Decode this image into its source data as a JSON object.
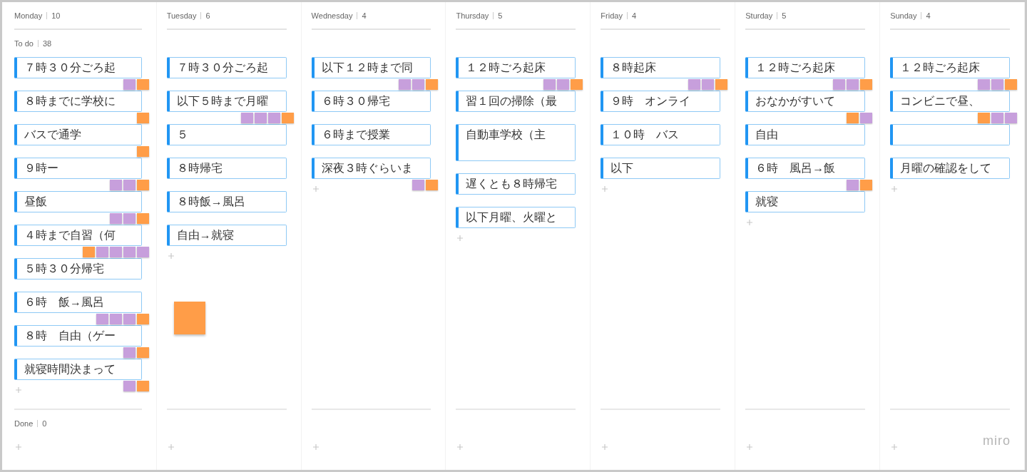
{
  "columns": [
    {
      "day": "Monday",
      "count": "10",
      "lane": {
        "label": "To do",
        "count": "38"
      },
      "cards": [
        {
          "text": "７時３０分ごろ起",
          "stickies": [
            {
              "color": "#c79fdc"
            },
            {
              "color": "#ff9d48"
            }
          ]
        },
        {
          "text": "８時までに学校に",
          "stickies": [
            {
              "color": "#ff9d48"
            }
          ]
        },
        {
          "text": "バスで通学",
          "stickies": [
            {
              "color": "#ff9d48"
            }
          ]
        },
        {
          "text": "９時ー",
          "stickies": [
            {
              "color": "#c79fdc"
            },
            {
              "color": "#c79fdc"
            },
            {
              "color": "#ff9d48"
            }
          ]
        },
        {
          "text": "昼飯",
          "stickies": [
            {
              "color": "#c79fdc"
            },
            {
              "color": "#c79fdc"
            },
            {
              "color": "#ff9d48"
            }
          ]
        },
        {
          "text": "４時まで自習（何",
          "stickies": [
            {
              "color": "#ff9d48"
            },
            {
              "color": "#c79fdc"
            },
            {
              "color": "#c79fdc"
            },
            {
              "color": "#c79fdc"
            },
            {
              "color": "#c79fdc"
            }
          ]
        },
        {
          "text": "５時３０分帰宅"
        },
        {
          "text": "６時　飯→風呂",
          "stickies": [
            {
              "color": "#c79fdc"
            },
            {
              "color": "#c79fdc"
            },
            {
              "color": "#c79fdc"
            },
            {
              "color": "#ff9d48"
            }
          ]
        },
        {
          "text": "８時　自由（ゲー",
          "stickies": [
            {
              "color": "#c79fdc"
            },
            {
              "color": "#ff9d48"
            }
          ]
        },
        {
          "text": "就寝時間決まって",
          "stickies": [
            {
              "color": "#c79fdc"
            },
            {
              "color": "#ff9d48"
            }
          ]
        }
      ]
    },
    {
      "day": "Tuesday",
      "count": "6",
      "cards": [
        {
          "text": "７時３０分ごろ起"
        },
        {
          "text": "以下５時まで月曜",
          "stickies": [
            {
              "color": "#c79fdc"
            },
            {
              "color": "#c79fdc"
            },
            {
              "color": "#c79fdc"
            },
            {
              "color": "#ff9d48"
            }
          ]
        },
        {
          "text": "５"
        },
        {
          "text": "８時帰宅"
        },
        {
          "text": "８時飯→風呂"
        },
        {
          "text": "自由→就寝"
        }
      ],
      "loose": [
        {
          "color": "#ff9d48"
        }
      ]
    },
    {
      "day": "Wednesday",
      "count": "4",
      "cards": [
        {
          "text": "以下１２時まで同",
          "stickies": [
            {
              "color": "#c79fdc"
            },
            {
              "color": "#c79fdc"
            },
            {
              "color": "#ff9d48"
            }
          ]
        },
        {
          "text": "６時３０帰宅"
        },
        {
          "text": "６時まで授業"
        },
        {
          "text": "深夜３時ぐらいま",
          "stickies": [
            {
              "color": "#c79fdc"
            },
            {
              "color": "#ff9d48"
            }
          ]
        }
      ]
    },
    {
      "day": "Thursday",
      "count": "5",
      "cards": [
        {
          "text": "１２時ごろ起床",
          "stickies": [
            {
              "color": "#c79fdc"
            },
            {
              "color": "#c79fdc"
            },
            {
              "color": "#ff9d48"
            }
          ]
        },
        {
          "text": "習１回の掃除（最"
        },
        {
          "text": "自動車学校（主",
          "tall": true
        },
        {
          "text": "遅くとも８時帰宅"
        },
        {
          "text": "以下月曜、火曜と"
        }
      ]
    },
    {
      "day": "Friday",
      "count": "4",
      "cards": [
        {
          "text": "８時起床",
          "stickies": [
            {
              "color": "#c79fdc"
            },
            {
              "color": "#c79fdc"
            },
            {
              "color": "#ff9d48"
            }
          ]
        },
        {
          "text": "９時　オンライ"
        },
        {
          "text": "１０時　バス"
        },
        {
          "text": "以下"
        }
      ]
    },
    {
      "day": "Sturday",
      "count": "5",
      "cards": [
        {
          "text": "１２時ごろ起床",
          "stickies": [
            {
              "color": "#c79fdc"
            },
            {
              "color": "#c79fdc"
            },
            {
              "color": "#ff9d48"
            }
          ]
        },
        {
          "text": "おなかがすいて",
          "stickies": [
            {
              "color": "#ff9d48"
            },
            {
              "color": "#c79fdc"
            }
          ]
        },
        {
          "text": "自由"
        },
        {
          "text": "６時　風呂→飯",
          "stickies": [
            {
              "color": "#c79fdc"
            },
            {
              "color": "#ff9d48"
            }
          ]
        },
        {
          "text": "就寝"
        }
      ]
    },
    {
      "day": "Sunday",
      "count": "4",
      "cards": [
        {
          "text": "１２時ごろ起床",
          "stickies": [
            {
              "color": "#c79fdc"
            },
            {
              "color": "#c79fdc"
            },
            {
              "color": "#ff9d48"
            }
          ]
        },
        {
          "text": "コンビニで昼、",
          "stickies": [
            {
              "color": "#ff9d48"
            },
            {
              "color": "#c79fdc"
            },
            {
              "color": "#c79fdc"
            }
          ]
        },
        {
          "kind": "blank"
        },
        {
          "text": "月曜の確認をして"
        }
      ]
    }
  ],
  "done_lane": {
    "label": "Done",
    "count": "0"
  },
  "logo": "miro"
}
